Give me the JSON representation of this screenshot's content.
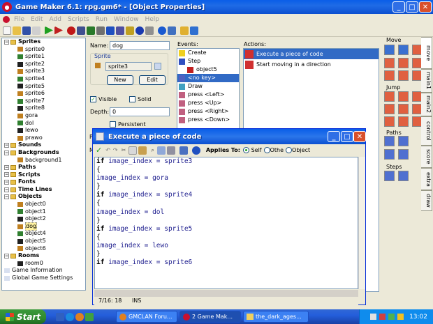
{
  "window": {
    "title": "Game Maker 6.1: rpg.gm6* - [Object Properties]"
  },
  "menu": [
    "File",
    "Edit",
    "Add",
    "Scripts",
    "Run",
    "Window",
    "Help"
  ],
  "tree": [
    {
      "label": "Sprites",
      "level": 0,
      "type": "folder",
      "top": true
    },
    {
      "label": "sprite0",
      "level": 1
    },
    {
      "label": "sprite1",
      "level": 1
    },
    {
      "label": "sprite2",
      "level": 1
    },
    {
      "label": "sprite3",
      "level": 1
    },
    {
      "label": "sprite4",
      "level": 1
    },
    {
      "label": "sprite5",
      "level": 1
    },
    {
      "label": "sprite6",
      "level": 1
    },
    {
      "label": "sprite7",
      "level": 1
    },
    {
      "label": "sprite8",
      "level": 1
    },
    {
      "label": "gora",
      "level": 1
    },
    {
      "label": "dol",
      "level": 1
    },
    {
      "label": "lewo",
      "level": 1
    },
    {
      "label": "prawo",
      "level": 1
    },
    {
      "label": "Sounds",
      "level": 0,
      "type": "folder",
      "top": true
    },
    {
      "label": "Backgrounds",
      "level": 0,
      "type": "folder",
      "top": true
    },
    {
      "label": "background1",
      "level": 1
    },
    {
      "label": "Paths",
      "level": 0,
      "type": "folder",
      "top": true
    },
    {
      "label": "Scripts",
      "level": 0,
      "type": "folder",
      "top": true
    },
    {
      "label": "Fonts",
      "level": 0,
      "type": "folder",
      "top": true
    },
    {
      "label": "Time Lines",
      "level": 0,
      "type": "folder",
      "top": true
    },
    {
      "label": "Objects",
      "level": 0,
      "type": "folder",
      "top": true
    },
    {
      "label": "object0",
      "level": 1
    },
    {
      "label": "object1",
      "level": 1
    },
    {
      "label": "object2",
      "level": 1
    },
    {
      "label": "dog",
      "level": 1,
      "selected": true
    },
    {
      "label": "object4",
      "level": 1
    },
    {
      "label": "object5",
      "level": 1
    },
    {
      "label": "object6",
      "level": 1
    },
    {
      "label": "Rooms",
      "level": 0,
      "type": "folder",
      "top": true
    },
    {
      "label": "room0",
      "level": 1
    },
    {
      "label": "Game Information",
      "level": 0,
      "type": "doc"
    },
    {
      "label": "Global Game Settings",
      "level": 0,
      "type": "doc"
    }
  ],
  "props": {
    "name_label": "Name:",
    "name_value": "dog",
    "sprite_label": "Sprite",
    "sprite_value": "sprite3",
    "new_btn": "New",
    "edit_btn": "Edit",
    "visible_label": "Visible",
    "solid_label": "Solid",
    "depth_label": "Depth:",
    "depth_value": "0",
    "persistent_label": "Persistent",
    "parent_label": "Pa",
    "mask_label": "Ma"
  },
  "events": {
    "header": "Events:",
    "items": [
      "Create",
      "Step",
      "object5",
      "<no key>",
      "Draw",
      "press <Left>",
      "press <Up>",
      "press <Right>",
      "press <Down>"
    ]
  },
  "actions": {
    "header": "Actions:",
    "items": [
      "Execute a piece of code",
      "Start moving in a direction"
    ]
  },
  "palette": {
    "sections": [
      "Move",
      "Jump",
      "Paths",
      "Steps"
    ]
  },
  "tabs": [
    "move",
    "main1",
    "main2",
    "control",
    "score",
    "extra",
    "draw"
  ],
  "dialog": {
    "title": "Execute a piece of code",
    "applies_to": "Applies To:",
    "self": "Self",
    "other": "Othe",
    "object": "Object",
    "status_pos": "7/16:  18",
    "status_mode": "INS",
    "code": [
      {
        "kw": "if ",
        "rest": "image_index = sprite3"
      },
      {
        "kw": "",
        "rest": "{"
      },
      {
        "kw": "",
        "rest": "image_index = gora"
      },
      {
        "kw": "",
        "rest": "}"
      },
      {
        "kw": "if ",
        "rest": "image_index = sprite4"
      },
      {
        "kw": "",
        "rest": "{"
      },
      {
        "kw": "",
        "rest": "image_index = dol"
      },
      {
        "kw": "",
        "rest": "}"
      },
      {
        "kw": "if ",
        "rest": "image_index = sprite5"
      },
      {
        "kw": "",
        "rest": "{"
      },
      {
        "kw": "",
        "rest": "image_index = lewo"
      },
      {
        "kw": "",
        "rest": "}"
      },
      {
        "kw": "if ",
        "rest": "image_index = sprite6"
      }
    ]
  },
  "taskbar": {
    "start": "Start",
    "tasks": [
      "GMCLAN Foru...",
      "2 Game Mak...",
      "the_dark_ages..."
    ],
    "clock": "13:02"
  }
}
